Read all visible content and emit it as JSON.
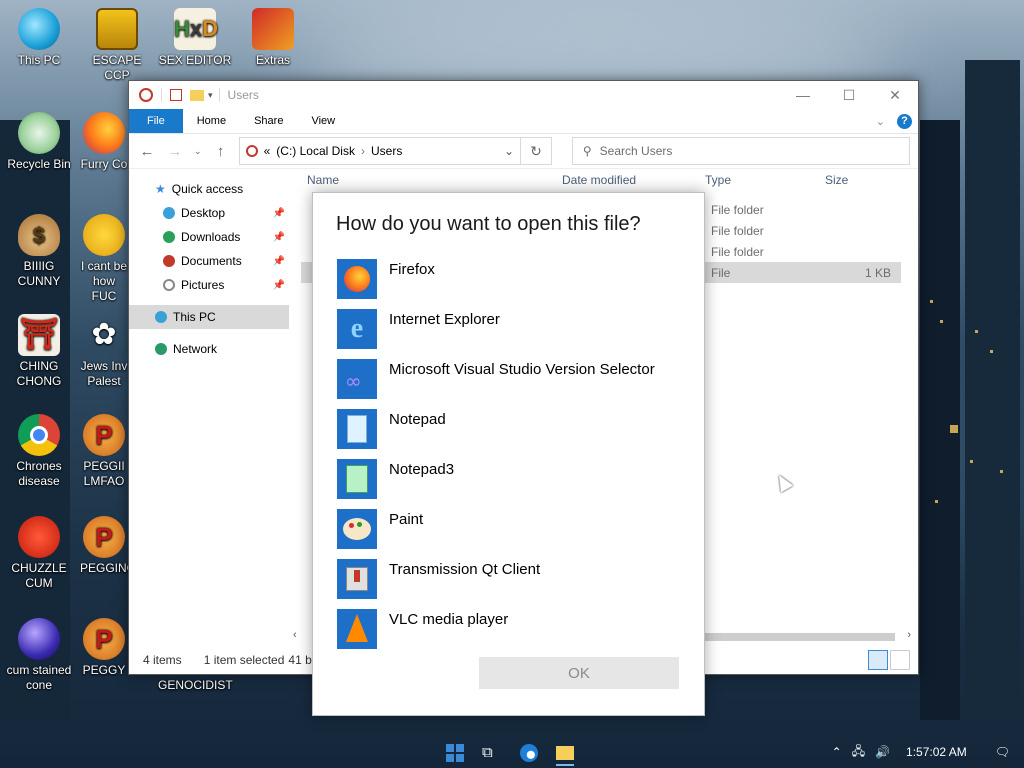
{
  "desktop": {
    "icons": [
      {
        "label": "This PC",
        "icon": "this-pc-icon"
      },
      {
        "label": "ESCAPE CCP",
        "icon": "app-icon"
      },
      {
        "label": "SEX EDITOR",
        "icon": "hxd-icon"
      },
      {
        "label": "Extras",
        "icon": "extras-icon"
      },
      {
        "label": "Recycle Bin",
        "icon": "recycle-bin-icon"
      },
      {
        "label": "Furry Co",
        "icon": "firefox-icon"
      },
      {
        "label": "BIIIIG CUNNY",
        "icon": "money-bag-icon"
      },
      {
        "label": "I cant be how FUC",
        "icon": "emoji-icon"
      },
      {
        "label": "CHING CHONG",
        "icon": "torii-icon"
      },
      {
        "label": "Jews Inv Palest",
        "icon": "flower-icon"
      },
      {
        "label": "Chrones disease",
        "icon": "chrome-icon"
      },
      {
        "label": "PEGGII LMFAO",
        "icon": "pegging-icon"
      },
      {
        "label": "CHUZZLE CUM",
        "icon": "chuzzle-icon"
      },
      {
        "label": "PEGGING",
        "icon": "pegging-icon"
      },
      {
        "label": "cum stained cone",
        "icon": "orb-icon"
      },
      {
        "label": "PEGGY",
        "icon": "pegging-icon"
      },
      {
        "label": "GENOCIDIST",
        "icon": "app-icon"
      }
    ]
  },
  "explorer": {
    "title": "Users",
    "ribbon_tabs": [
      "File",
      "Home",
      "Share",
      "View"
    ],
    "address": {
      "prefix": "«",
      "drive": "(C:) Local Disk",
      "sep": "›",
      "folder": "Users"
    },
    "search_placeholder": "Search Users",
    "nav": {
      "quick_access": "Quick access",
      "items": [
        "Desktop",
        "Downloads",
        "Documents",
        "Pictures"
      ],
      "this_pc": "This PC",
      "network": "Network"
    },
    "columns": {
      "name": "Name",
      "date": "Date modified",
      "type": "Type",
      "size": "Size"
    },
    "rows": [
      {
        "type": "File folder",
        "size": ""
      },
      {
        "type": "File folder",
        "size": ""
      },
      {
        "type": "File folder",
        "size": ""
      },
      {
        "type": "File",
        "size": "1 KB"
      }
    ],
    "status": {
      "items": "4 items",
      "selected": "1 item selected",
      "size_partial": "41 b"
    }
  },
  "dialog": {
    "title": "How do you want to open this file?",
    "apps": [
      {
        "name": "Firefox",
        "icon": "firefox-icon"
      },
      {
        "name": "Internet Explorer",
        "icon": "internet-explorer-icon"
      },
      {
        "name": "Microsoft Visual Studio Version Selector",
        "icon": "visual-studio-icon"
      },
      {
        "name": "Notepad",
        "icon": "notepad-icon"
      },
      {
        "name": "Notepad3",
        "icon": "notepad3-icon"
      },
      {
        "name": "Paint",
        "icon": "paint-icon"
      },
      {
        "name": "Transmission Qt Client",
        "icon": "transmission-icon"
      },
      {
        "name": "VLC media player",
        "icon": "vlc-icon"
      }
    ],
    "ok_label": "OK"
  },
  "taskbar": {
    "clock": "1:57:02 AM",
    "accent": "#1979ca"
  }
}
